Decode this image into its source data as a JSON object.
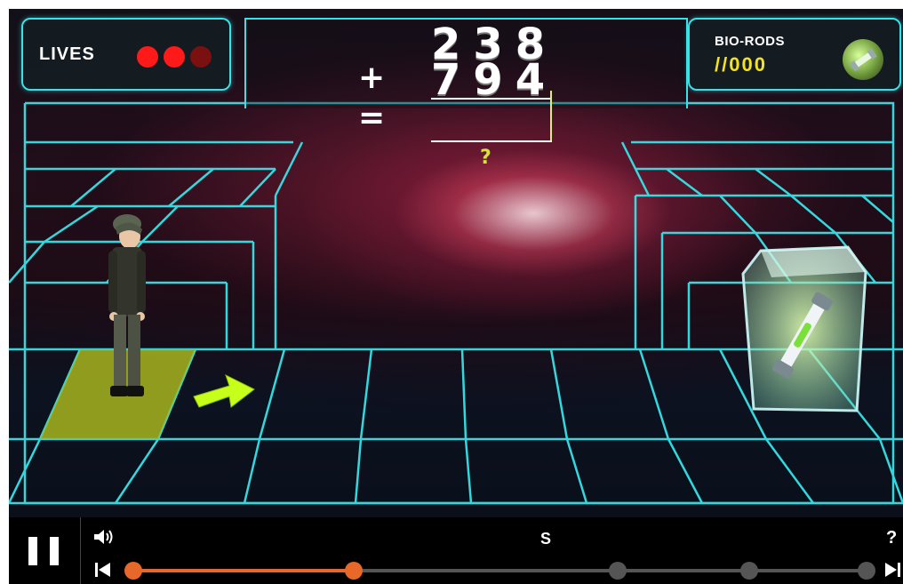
{
  "hud": {
    "lives_label": "LIVES",
    "lives_total": 3,
    "lives_remaining": 2,
    "bio_rods_label": "BIO-RODS",
    "bio_rods_count": "//000"
  },
  "problem": {
    "top_number": "238",
    "bottom_number": "794",
    "operator": "+",
    "equals": "=",
    "answer": "",
    "hint": "?"
  },
  "colors": {
    "grid": "#35e3e8",
    "life_on": "#ff1a1a",
    "life_off": "#7a1010",
    "accent_yellow": "#f4e21a",
    "progress": "#e8682a"
  },
  "controls": {
    "pause_icon": "pause-icon",
    "volume_icon": "volume-icon",
    "subtitle_label": "S",
    "help_label": "?",
    "progress_stages": 6,
    "progress_current_index": 1
  }
}
